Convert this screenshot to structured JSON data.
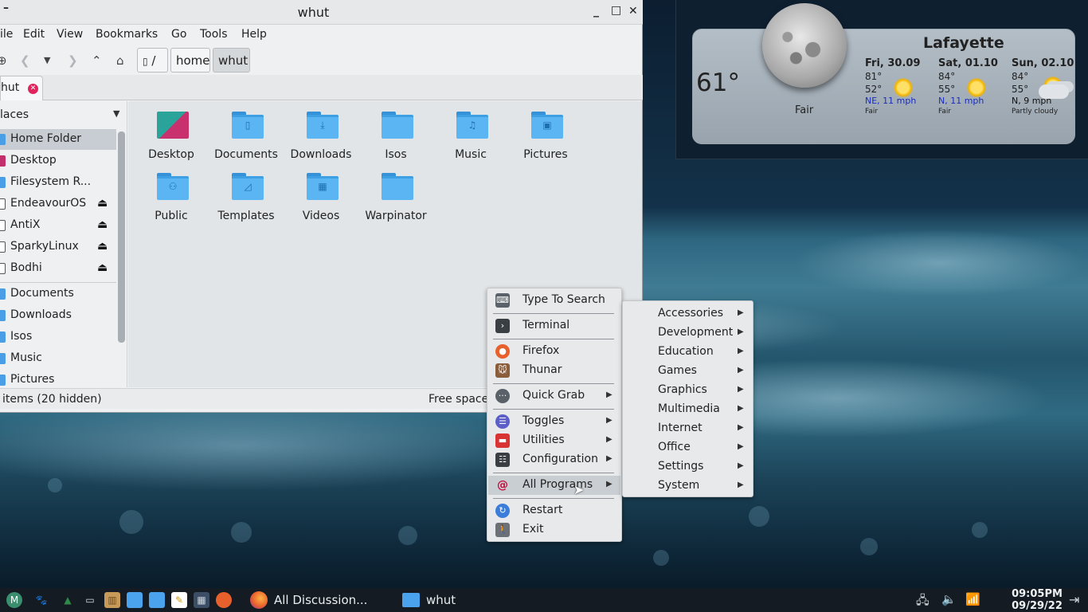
{
  "weather": {
    "city": "Lafayette",
    "current_temp": "61°",
    "current_condition": "Fair",
    "forecast": [
      {
        "day": "Fri, 30.09",
        "high": "81°",
        "low": "52°",
        "wind": "NE, 11 mph",
        "condition": "Fair",
        "icon": "sun-icon"
      },
      {
        "day": "Sat, 01.10",
        "high": "84°",
        "low": "55°",
        "wind": "N, 11 mph",
        "condition": "Fair",
        "icon": "sun-icon"
      },
      {
        "day": "Sun, 02.10",
        "high": "84°",
        "low": "55°",
        "wind": "N, 9 mph",
        "condition": "Partly cloudy",
        "icon": "partly-cloudy-icon"
      }
    ]
  },
  "window": {
    "title": "whut",
    "minimize": "_",
    "maximize": "□",
    "close": "✕",
    "menu_glyph": "–"
  },
  "menubar": [
    "ile",
    "Edit",
    "View",
    "Bookmarks",
    "Go",
    "Tools",
    "Help"
  ],
  "toolbar": {
    "root_crumb": "/",
    "crumbs": [
      "home",
      "whut"
    ]
  },
  "tab": {
    "label": "hut",
    "close": "✕"
  },
  "places": {
    "header": "laces",
    "caret": "▼",
    "items": [
      {
        "label": "Home Folder",
        "selected": true,
        "type": "folder"
      },
      {
        "label": "Desktop",
        "type": "desktop"
      },
      {
        "label": "Filesystem R...",
        "type": "folder"
      },
      {
        "label": "EndeavourOS",
        "type": "drive",
        "eject": "⏏"
      },
      {
        "label": "AntiX",
        "type": "drive",
        "eject": "⏏"
      },
      {
        "label": "SparkyLinux",
        "type": "drive",
        "eject": "⏏"
      },
      {
        "label": "Bodhi",
        "type": "drive",
        "eject": "⏏"
      }
    ],
    "bookmarks": [
      {
        "label": "Documents"
      },
      {
        "label": "Downloads"
      },
      {
        "label": "Isos"
      },
      {
        "label": "Music"
      },
      {
        "label": "Pictures"
      }
    ]
  },
  "folders": [
    {
      "label": "Desktop",
      "glyph": ""
    },
    {
      "label": "Documents",
      "glyph": "▯"
    },
    {
      "label": "Downloads",
      "glyph": "⤓"
    },
    {
      "label": "Isos",
      "glyph": ""
    },
    {
      "label": "Music",
      "glyph": "♫"
    },
    {
      "label": "Pictures",
      "glyph": "▣"
    },
    {
      "label": "Public",
      "glyph": "⚇"
    },
    {
      "label": "Templates",
      "glyph": "◿"
    },
    {
      "label": "Videos",
      "glyph": "▦"
    },
    {
      "label": "Warpinator",
      "glyph": ""
    }
  ],
  "status": {
    "left": "items (20 hidden)",
    "right": "Free space"
  },
  "root_menu": [
    {
      "label": "Type To Search",
      "icon": "keyboard-icon",
      "glyph": "⌨",
      "color": "#5a6168"
    },
    {
      "label": "Terminal",
      "icon": "terminal-icon",
      "glyph": "›",
      "color": "#3a3f44"
    },
    {
      "label": "Firefox",
      "icon": "firefox-icon",
      "glyph": "●",
      "color": "#e8602c"
    },
    {
      "label": "Thunar",
      "icon": "thunar-icon",
      "glyph": "🐭",
      "color": "#8a5d3b"
    },
    {
      "label": "Quick Grab",
      "icon": "screenshot-icon",
      "glyph": "···",
      "color": "#5a6168",
      "submenu": true
    },
    {
      "label": "Toggles",
      "icon": "toggles-icon",
      "glyph": "☰",
      "color": "#5b5fc7",
      "submenu": true
    },
    {
      "label": "Utilities",
      "icon": "toolbox-icon",
      "glyph": "▬",
      "color": "#d83434",
      "submenu": true
    },
    {
      "label": "Configuration",
      "icon": "configuration-icon",
      "glyph": "☷",
      "color": "#3a3f44",
      "submenu": true
    },
    {
      "label": "All Programs",
      "icon": "debian-swirl-icon",
      "glyph": "@",
      "color": "#c7093a",
      "submenu": true,
      "hover": true
    },
    {
      "label": "Restart",
      "icon": "restart-icon",
      "glyph": "↻",
      "color": "#3b7dd8"
    },
    {
      "label": "Exit",
      "icon": "exit-icon",
      "glyph": "🚶",
      "color": "#6b7177"
    }
  ],
  "sub_menu": [
    "Accessories",
    "Development",
    "Education",
    "Games",
    "Graphics",
    "Multimedia",
    "Internet",
    "Office",
    "Settings",
    "System"
  ],
  "submenu_arrow": "▶",
  "taskbar": {
    "launchers": [
      {
        "icon": "menu-logo-icon",
        "glyph": "M",
        "color": "#3a8e6e"
      },
      {
        "icon": "paw-icon",
        "glyph": "🐾",
        "color": "#5aa0d8"
      },
      {
        "icon": "image-viewer-icon",
        "glyph": "▲",
        "color": "#2f8a4a"
      },
      {
        "icon": "monitor-icon",
        "glyph": "▭",
        "color": "#d8dde2"
      },
      {
        "icon": "package-icon",
        "glyph": "▥",
        "color": "#c89a5a"
      },
      {
        "icon": "folder-icon",
        "glyph": "▬",
        "color": "#4aa3ec"
      },
      {
        "icon": "folder-icon",
        "glyph": "▬",
        "color": "#4aa3ec"
      },
      {
        "icon": "text-editor-icon",
        "glyph": "✎",
        "color": "#f1c232"
      },
      {
        "icon": "calculator-icon",
        "glyph": "▦",
        "color": "#3b4e66"
      },
      {
        "icon": "firefox-icon",
        "glyph": "●",
        "color": "#e8602c"
      }
    ],
    "tasks": [
      {
        "label": "All Discussion...",
        "icon": "firefox-icon"
      },
      {
        "label": "whut",
        "icon": "folder-icon"
      }
    ],
    "tray": [
      {
        "icon": "network-icon",
        "glyph": "🖧"
      },
      {
        "icon": "volume-icon",
        "glyph": "🔈"
      },
      {
        "icon": "wireless-icon",
        "glyph": "📶"
      }
    ],
    "time": "09:05PM",
    "date": "09/29/22",
    "logout_glyph": "⇥"
  }
}
